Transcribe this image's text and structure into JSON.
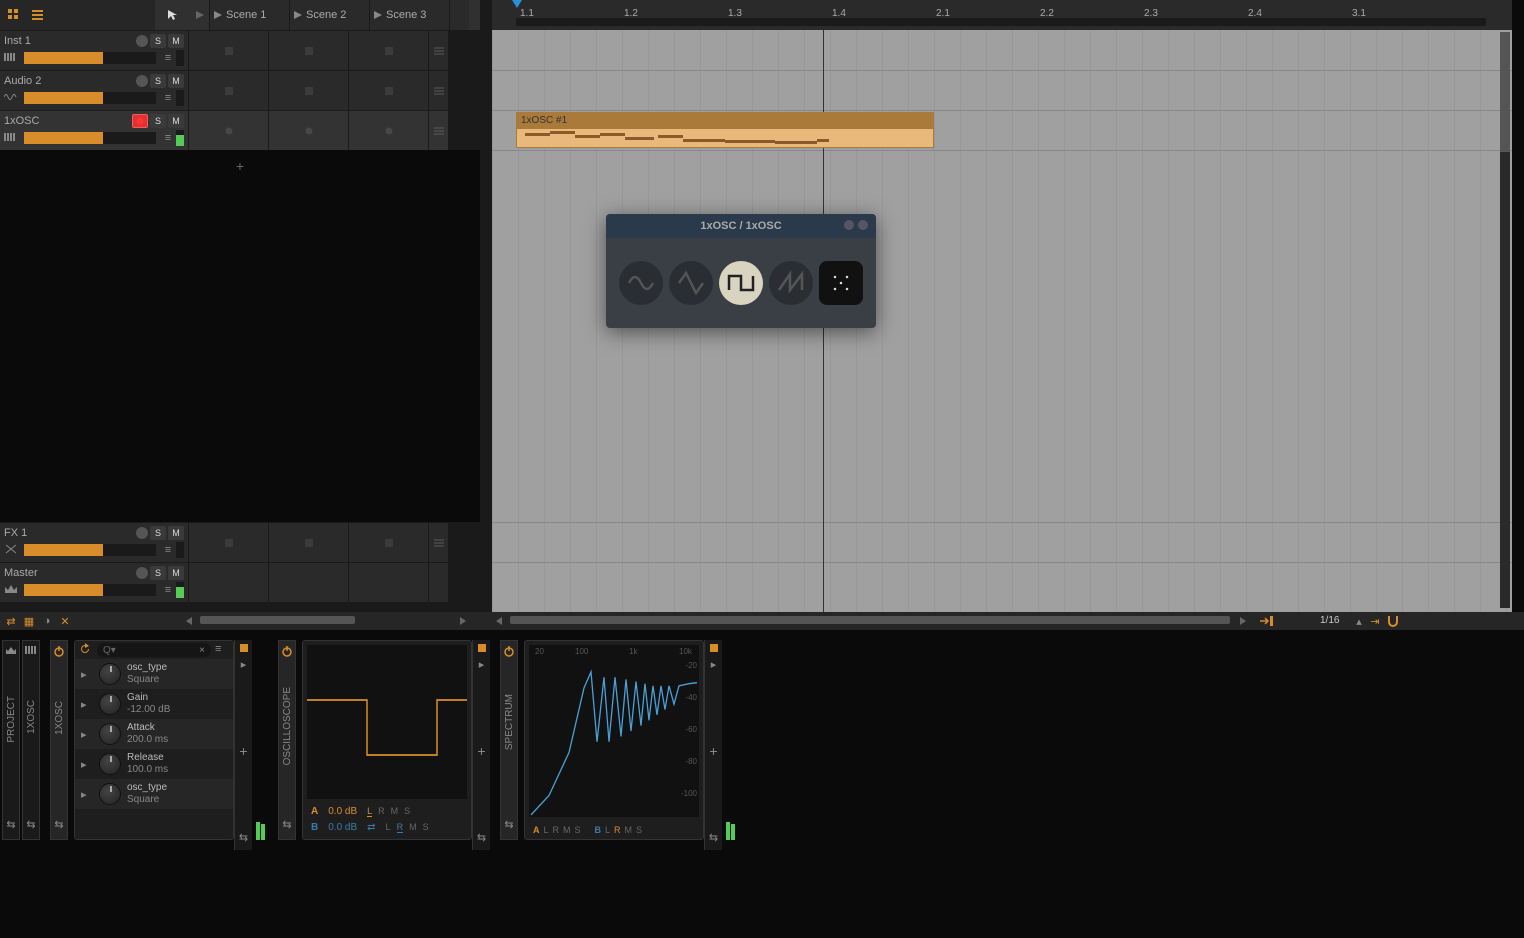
{
  "toolbar": {
    "scenes": [
      "Scene 1",
      "Scene 2",
      "Scene 3"
    ]
  },
  "tracks": [
    {
      "name": "Inst 1",
      "type": "midi",
      "rec": false,
      "vol": 60,
      "meter": 0
    },
    {
      "name": "Audio 2",
      "type": "audio",
      "rec": false,
      "vol": 60,
      "meter": 0
    },
    {
      "name": "1xOSC",
      "type": "midi",
      "rec": true,
      "vol": 60,
      "meter": 70
    }
  ],
  "fx": {
    "name": "FX 1",
    "vol": 60,
    "meter": 0
  },
  "master": {
    "name": "Master",
    "vol": 60,
    "meter": 70
  },
  "ruler": {
    "ticks": [
      "1.1",
      "1.2",
      "1.3",
      "1.4",
      "2.1",
      "2.2",
      "2.3",
      "2.4",
      "3.1"
    ]
  },
  "clip": {
    "name": "1xOSC #1"
  },
  "grid_setting": "1/16",
  "plugin": {
    "title": "1xOSC / 1xOSC",
    "waves": [
      "sine",
      "triangle",
      "square",
      "saw",
      "noise"
    ],
    "selected": "square"
  },
  "device": {
    "search_placeholder": "Q▾",
    "side_labels": [
      "PROJECT",
      "1XOSC",
      "1XOSC",
      "OSCILLOSCOPE",
      "SPECTRUM"
    ],
    "params": [
      {
        "name": "osc_type",
        "val": "Square"
      },
      {
        "name": "Gain",
        "val": "-12.00 dB"
      },
      {
        "name": "Attack",
        "val": "200.0 ms"
      },
      {
        "name": "Release",
        "val": "100.0 ms"
      },
      {
        "name": "osc_type",
        "val": "Square"
      }
    ],
    "osc": {
      "a_db": "0.0 dB",
      "b_db": "0.0 dB"
    },
    "spectrum": {
      "freq_labels": [
        "20",
        "100",
        "1k",
        "10k"
      ],
      "db_labels": [
        "-20",
        "-40",
        "-60",
        "-80",
        "-100"
      ]
    }
  }
}
